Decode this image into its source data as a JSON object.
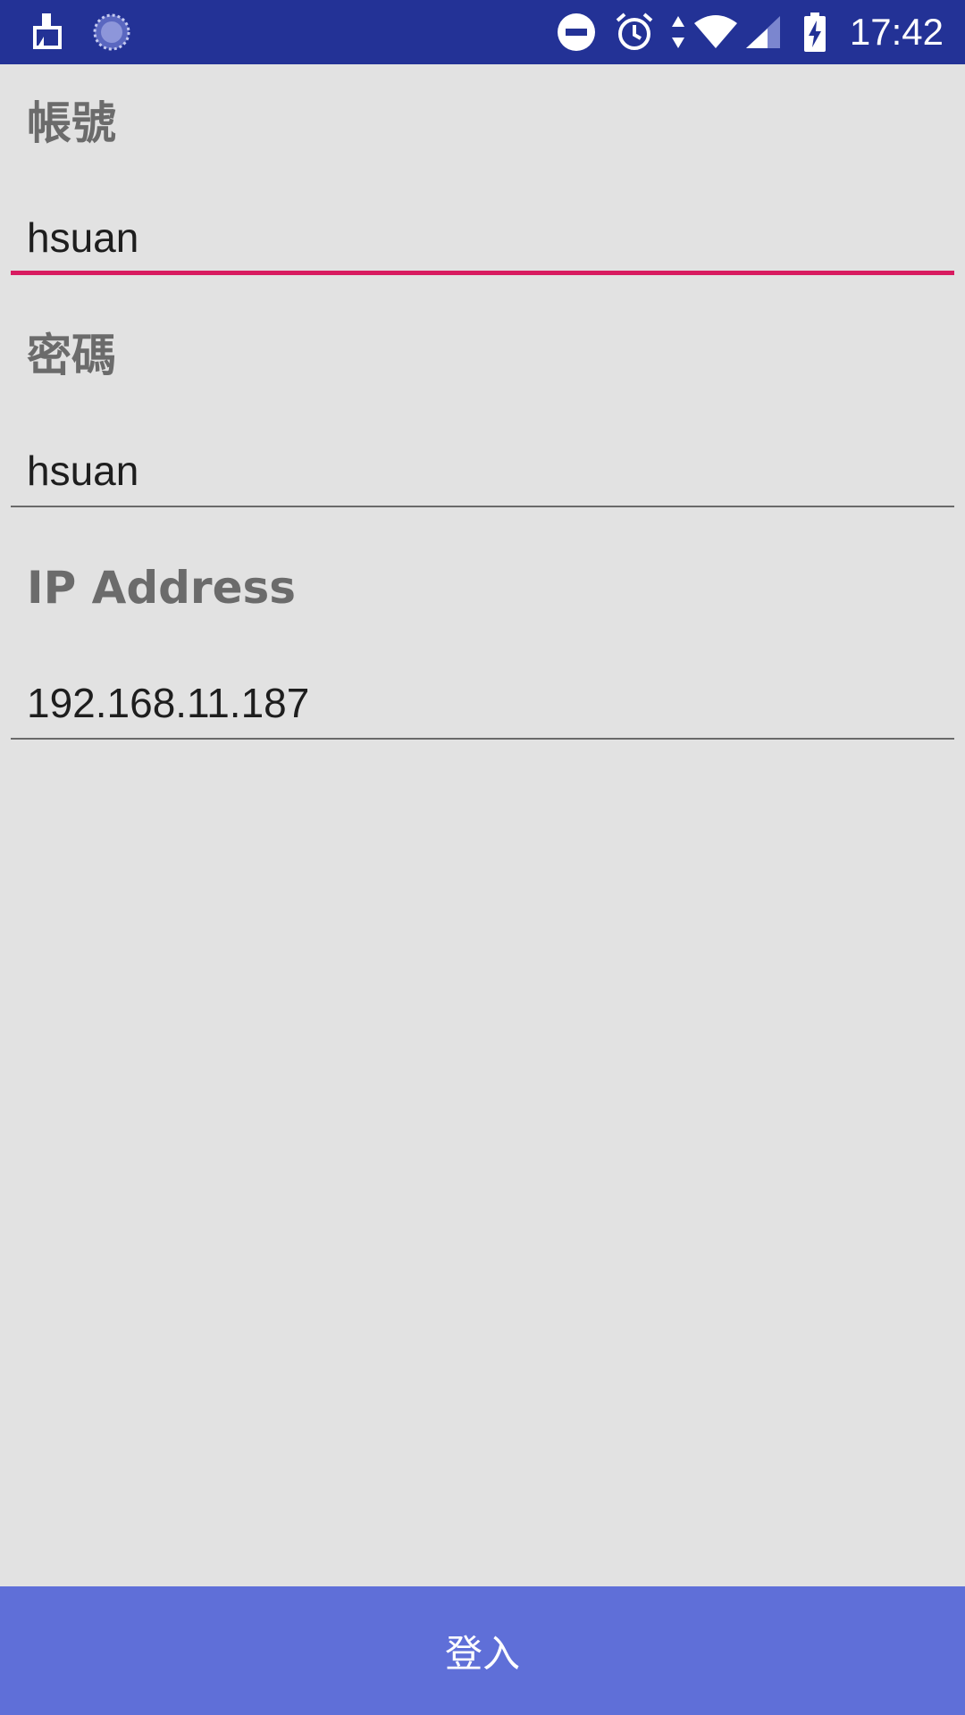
{
  "status_bar": {
    "time": "17:42",
    "icons": [
      "cleaner-app-icon",
      "loading-spinner-icon",
      "do-not-disturb-icon",
      "alarm-icon",
      "data-arrows-icon",
      "wifi-icon",
      "cell-signal-icon",
      "battery-charging-icon"
    ]
  },
  "form": {
    "account_label": "帳號",
    "account_value": "hsuan",
    "password_label": "密碼",
    "password_value": "hsuan",
    "ip_label": "IP Address",
    "ip_value": "192.168.11.187"
  },
  "login_button": {
    "label": "登入"
  },
  "colors": {
    "status_bar": "#233296",
    "background": "#e2e2e2",
    "focus_underline": "#d81b60",
    "button": "#5f6fd8"
  }
}
